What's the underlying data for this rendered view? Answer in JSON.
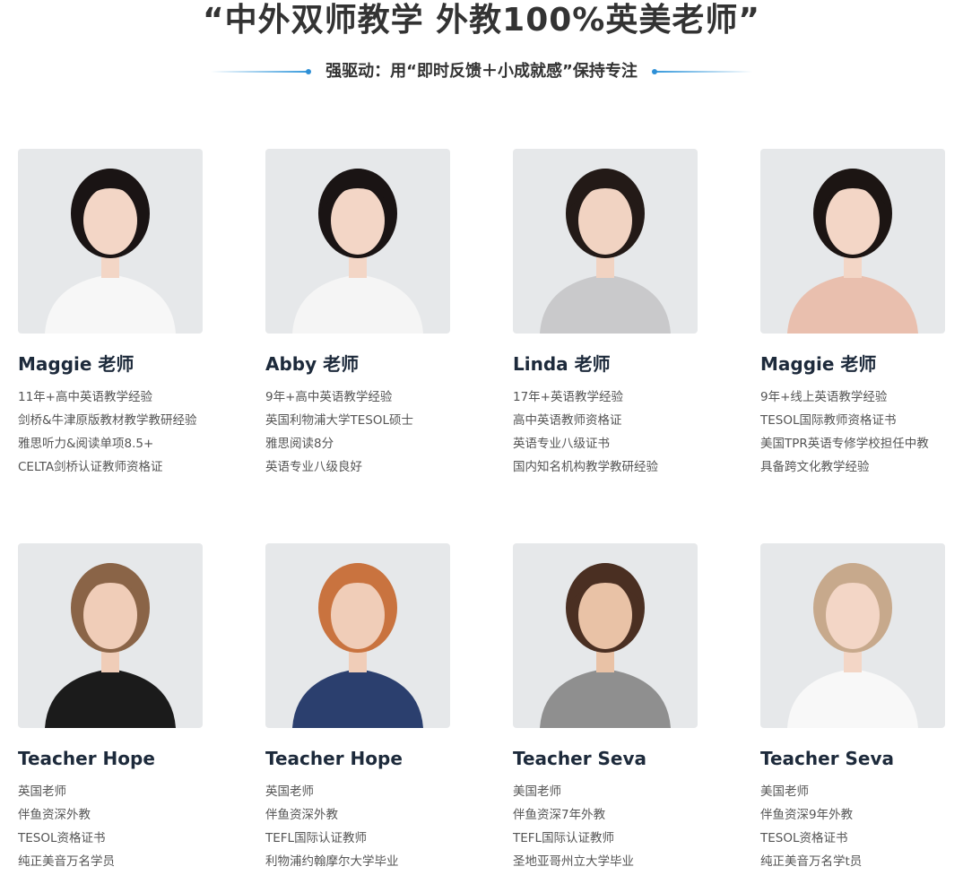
{
  "header": {
    "title": "“中外双师教学 外教100%英美老师”",
    "subtitle": "强驱动：用“即时反馈＋小成就感”保持专注"
  },
  "colors": {
    "accent": "#3498db",
    "photo_bg": "#e6e8ea",
    "name_text": "#1d2a3b"
  },
  "teachers": [
    {
      "name": "Maggie 老师",
      "lines": [
        "11年+高中英语教学经验",
        "剑桥&牛津原版教材教学教研经验",
        "雅思听力&阅读单项8.5+",
        "CELTA剑桥认证教师资格证"
      ],
      "hair": "#1a1414",
      "top": "#f7f7f7",
      "skin": "#f3d6c6"
    },
    {
      "name": "Abby 老师",
      "lines": [
        "9年+高中英语教学经验",
        "英国利物浦大学TESOL硕士",
        "雅思阅读8分",
        "英语专业八级良好"
      ],
      "hair": "#1a1414",
      "top": "#f5f5f5",
      "skin": "#f3d6c6"
    },
    {
      "name": "Linda 老师",
      "lines": [
        "17年+英语教学经验",
        "高中英语教师资格证",
        "英语专业八级证书",
        "国内知名机构教学教研经验"
      ],
      "hair": "#231a17",
      "top": "#c9c9cb",
      "skin": "#f1d3c2"
    },
    {
      "name": "Maggie 老师",
      "lines": [
        "9年+线上英语教学经验",
        "TESOL国际教师资格证书",
        "美国TPR英语专修学校担任中教",
        "具备跨文化教学经验"
      ],
      "hair": "#1c1513",
      "top": "#e9bfae",
      "skin": "#f3d6c6"
    },
    {
      "name": "Teacher Hope",
      "lines": [
        "英国老师",
        "伴鱼资深外教",
        "TESOL资格证书",
        "纯正美音万名学员"
      ],
      "hair": "#8a6447",
      "top": "#1b1b1b",
      "skin": "#f0cdb8"
    },
    {
      "name": "Teacher Hope",
      "lines": [
        "英国老师",
        "伴鱼资深外教",
        "TEFL国际认证教师",
        "利物浦约翰摩尔大学毕业"
      ],
      "hair": "#c9733f",
      "top": "#2b3f6e",
      "skin": "#f0cdb8"
    },
    {
      "name": "Teacher Seva",
      "lines": [
        "美国老师",
        "伴鱼资深7年外教",
        "TEFL国际认证教师",
        "圣地亚哥州立大学毕业"
      ],
      "hair": "#4a2f22",
      "top": "#8f8f8f",
      "skin": "#e9c2a6"
    },
    {
      "name": "Teacher Seva",
      "lines": [
        "美国老师",
        "伴鱼资深9年外教",
        "TESOL资格证书",
        "纯正美音万名学t员"
      ],
      "hair": "#c7a98c",
      "top": "#f8f8f8",
      "skin": "#f3d6c6"
    }
  ]
}
